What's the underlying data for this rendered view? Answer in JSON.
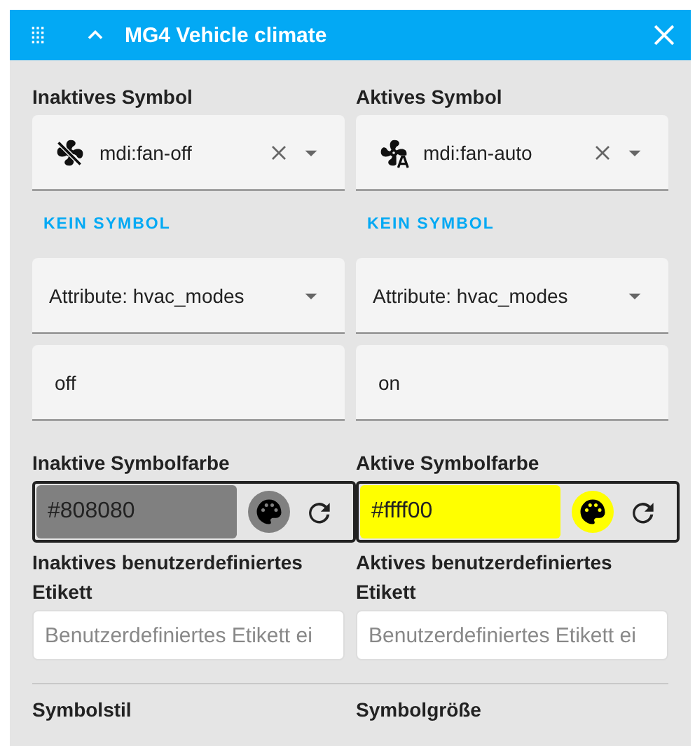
{
  "dialog": {
    "title": "MG4 Vehicle climate",
    "expanded": true
  },
  "columns": [
    {
      "icon_label": "Inaktives Symbol",
      "icon_value": "mdi:fan-off",
      "kind": "fan-off",
      "clear_label": "KEIN SYMBOL",
      "attribute": "Attribute: hvac_modes",
      "state_value": "off",
      "color_label": "Inaktive Symbolfarbe",
      "color_value": "#808080",
      "color": "#808080",
      "custom_label": "Inaktives benutzerdefiniertes Etikett",
      "custom_placeholder": "Benutzerdefiniertes Etikett ei",
      "next_label": "Symbolstil"
    },
    {
      "icon_label": "Aktives Symbol",
      "icon_value": "mdi:fan-auto",
      "kind": "fan-auto",
      "clear_label": "KEIN SYMBOL",
      "attribute": "Attribute: hvac_modes",
      "state_value": "on",
      "color_label": "Aktive Symbolfarbe",
      "color_value": "#ffff00",
      "color": "#ffff00",
      "custom_label": "Aktives benutzerdefiniertes Etikett",
      "custom_placeholder": "Benutzerdefiniertes Etikett ei",
      "next_label": "Symbolgröße"
    }
  ]
}
